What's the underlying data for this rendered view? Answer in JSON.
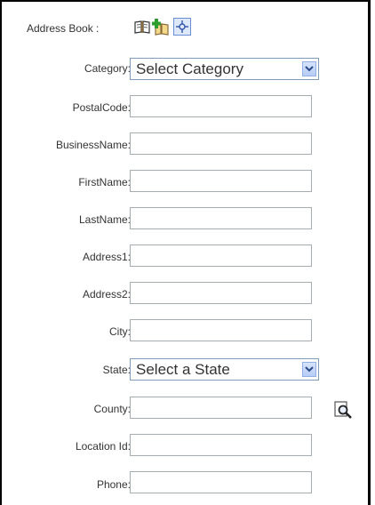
{
  "address_book": {
    "label": "Address Book :",
    "icons": [
      "open-book-icon",
      "add-book-icon",
      "locate-icon"
    ]
  },
  "form": {
    "category": {
      "label": "Category:",
      "selected": "Select Category"
    },
    "postal_code": {
      "label": "PostalCode:",
      "value": ""
    },
    "business_name": {
      "label": "BusinessName:",
      "value": ""
    },
    "first_name": {
      "label": "FirstName:",
      "value": ""
    },
    "last_name": {
      "label": "LastName:",
      "value": ""
    },
    "address1": {
      "label": "Address1:",
      "value": ""
    },
    "address2": {
      "label": "Address2:",
      "value": ""
    },
    "city": {
      "label": "City:",
      "value": ""
    },
    "state": {
      "label": "State:",
      "selected": "Select a State"
    },
    "county": {
      "label": "County:",
      "value": "",
      "lookup_icon": "magnifier-lookup-icon"
    },
    "location_id": {
      "label": "Location Id:",
      "value": ""
    },
    "phone": {
      "label": "Phone:",
      "value": ""
    }
  },
  "colors": {
    "frame_border": "#000000",
    "input_border": "#a5acb2",
    "dropdown_button": "#b7cdf5",
    "label_text": "#333333"
  }
}
